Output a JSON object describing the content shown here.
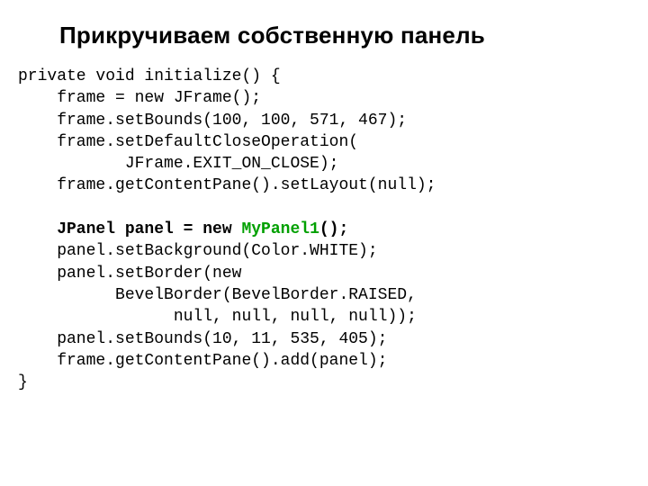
{
  "title": "Прикручиваем собственную панель",
  "code": {
    "l01": "private void initialize() {",
    "l02": "    frame = new JFrame();",
    "l03": "    frame.setBounds(100, 100, 571, 467);",
    "l04": "    frame.setDefaultCloseOperation(",
    "l05": "           JFrame.EXIT_ON_CLOSE);",
    "l06": "    frame.getContentPane().setLayout(null);",
    "l07": "",
    "l08a": "    JPanel panel = new ",
    "l08b": "MyPanel1",
    "l08c": "();",
    "l09": "    panel.setBackground(Color.WHITE);",
    "l10": "    panel.setBorder(new",
    "l11": "          BevelBorder(BevelBorder.RAISED,",
    "l12": "                null, null, null, null));",
    "l13": "    panel.setBounds(10, 11, 535, 405);",
    "l14": "    frame.getContentPane().add(panel);",
    "l15": "}"
  }
}
